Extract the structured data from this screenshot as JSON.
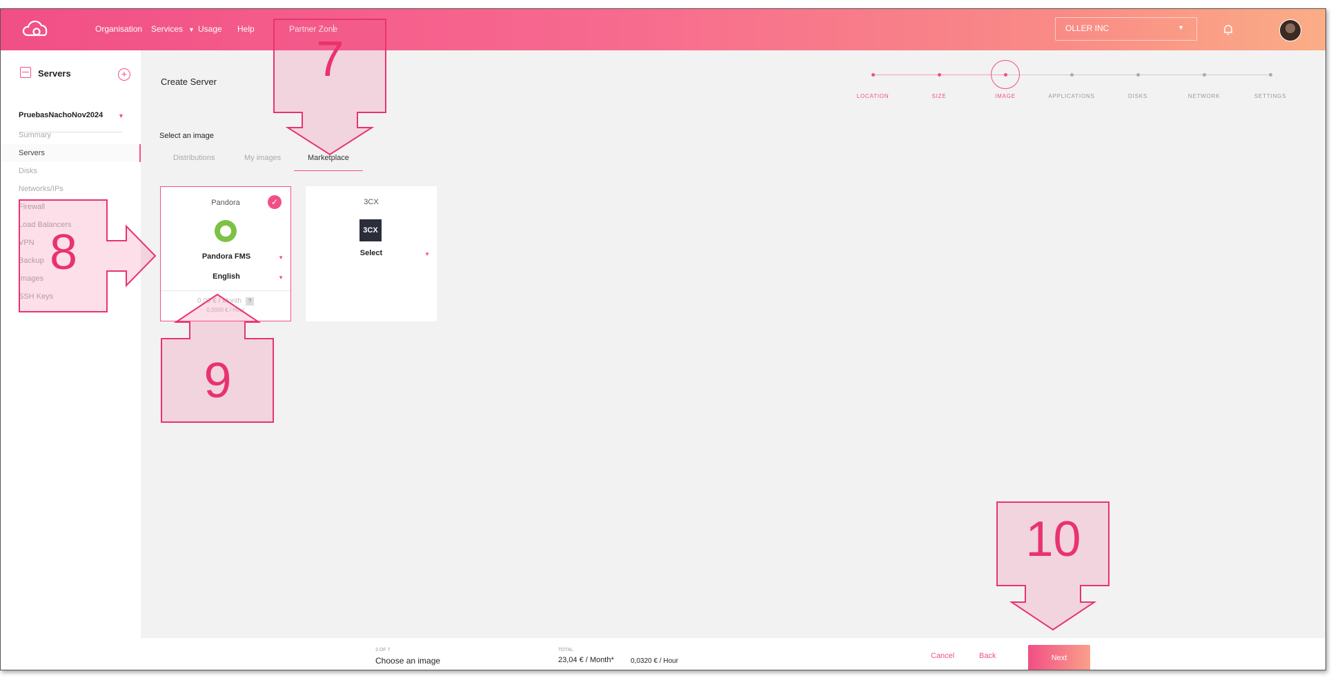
{
  "header": {
    "nav": [
      "Organisation",
      "Services",
      "Usage",
      "Help",
      "Partner Zone"
    ],
    "separator": "|",
    "org_selector": "OLLER INC"
  },
  "sidebar": {
    "title": "Servers",
    "project": "PruebasNachoNov2024",
    "items": [
      "Summary",
      "Servers",
      "Disks",
      "Networks/IPs",
      "Firewall",
      "Load Balancers",
      "VPN",
      "Backup",
      "Images",
      "SSH Keys"
    ],
    "active": "Servers"
  },
  "main": {
    "title": "Create Server",
    "steps": [
      "LOCATION",
      "SIZE",
      "IMAGE",
      "APPLICATIONS",
      "DISKS",
      "NETWORK",
      "SETTINGS"
    ],
    "current_step": "IMAGE",
    "select_label": "Select an image",
    "tabs": [
      "Distributions",
      "My images",
      "Marketplace"
    ],
    "active_tab": "Marketplace",
    "cards": [
      {
        "name": "Pandora",
        "app": "Pandora FMS",
        "language": "English",
        "price_month": "0,00 € / Month",
        "price_hour": "0,0000 € / Hour",
        "help": "?"
      },
      {
        "name": "3CX",
        "logo_text": "3CX",
        "app": "Select"
      }
    ]
  },
  "footer": {
    "step": "3 OF 7",
    "step_name": "Choose an image",
    "total_label": "TOTAL",
    "price_month": "23,04 € / Month*",
    "price_hour": "0,0320 € / Hour",
    "cancel": "Cancel",
    "back": "Back",
    "next": "Next"
  },
  "annotations": [
    "7",
    "8",
    "9",
    "10"
  ],
  "colors": {
    "accent": "#f14f86",
    "annotation": "#e8336f"
  }
}
